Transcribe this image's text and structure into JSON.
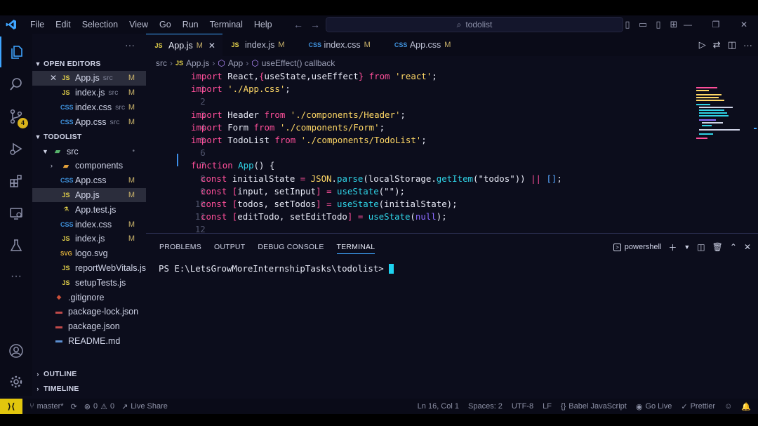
{
  "titlebar": {
    "menu": [
      "File",
      "Edit",
      "Selection",
      "View",
      "Go",
      "Run",
      "Terminal",
      "Help"
    ],
    "search": "todolist"
  },
  "activity": {
    "source_control_badge": "4"
  },
  "sidebar": {
    "open_editors_title": "OPEN EDITORS",
    "open_editors": [
      {
        "name": "App.js",
        "hint": "src",
        "status": "M",
        "icon": "JS"
      },
      {
        "name": "index.js",
        "hint": "src",
        "status": "M",
        "icon": "JS"
      },
      {
        "name": "index.css",
        "hint": "src",
        "status": "M",
        "icon": "CSS"
      },
      {
        "name": "App.css",
        "hint": "src",
        "status": "M",
        "icon": "CSS"
      }
    ],
    "project_title": "TODOLIST",
    "tree": [
      {
        "name": "src",
        "icon": "folder-src",
        "status": "•"
      },
      {
        "name": "components",
        "icon": "folder",
        "status": ""
      },
      {
        "name": "App.css",
        "icon": "CSS",
        "status": "M"
      },
      {
        "name": "App.js",
        "icon": "JS",
        "status": "M"
      },
      {
        "name": "App.test.js",
        "icon": "TEST",
        "status": ""
      },
      {
        "name": "index.css",
        "icon": "CSS",
        "status": "M"
      },
      {
        "name": "index.js",
        "icon": "JS",
        "status": "M"
      },
      {
        "name": "logo.svg",
        "icon": "SVG",
        "status": ""
      },
      {
        "name": "reportWebVitals.js",
        "icon": "JS",
        "status": ""
      },
      {
        "name": "setupTests.js",
        "icon": "JS",
        "status": ""
      },
      {
        "name": ".gitignore",
        "icon": "GIT",
        "status": ""
      },
      {
        "name": "package-lock.json",
        "icon": "JSON",
        "status": ""
      },
      {
        "name": "package.json",
        "icon": "JSON",
        "status": ""
      },
      {
        "name": "README.md",
        "icon": "MD",
        "status": ""
      }
    ],
    "outline_title": "OUTLINE",
    "timeline_title": "TIMELINE"
  },
  "tabs": [
    {
      "name": "App.js",
      "icon": "JS",
      "status": "M"
    },
    {
      "name": "index.js",
      "icon": "JS",
      "status": "M"
    },
    {
      "name": "index.css",
      "icon": "CSS",
      "status": "M"
    },
    {
      "name": "App.css",
      "icon": "CSS",
      "status": "M"
    }
  ],
  "breadcrumb": [
    "src",
    "App.js",
    "App",
    "useEffect() callback"
  ],
  "code_lines": [
    "1",
    "2",
    "3",
    "4",
    "5",
    "6",
    "7",
    "8",
    "9",
    "10",
    "11",
    "12",
    "13"
  ],
  "code": {
    "l1": [
      "import",
      " React,",
      "{",
      "useState,useEffect",
      "}",
      " from",
      " 'react'",
      ";"
    ],
    "l2": [
      "import",
      " './App.css'",
      ";"
    ],
    "l4": [
      "import",
      " Header",
      " from",
      " './components/Header'",
      ";"
    ],
    "l5": [
      "import",
      " Form",
      " from",
      " './components/Form'",
      ";"
    ],
    "l6": [
      "import",
      " TodoList",
      " from",
      " './components/TodoList'",
      ";"
    ],
    "l8": [
      "function",
      " App",
      "()",
      " {"
    ],
    "l9": [
      "const",
      " initialState",
      " =",
      " JSON",
      ".",
      "parse",
      "(",
      "localStorage",
      ".",
      "getItem",
      "(",
      "\"todos\"",
      "))",
      " ||",
      " []",
      ";"
    ],
    "l10": [
      "const",
      " [",
      "input, setInput",
      "]",
      " =",
      " useState",
      "(",
      "\"\"",
      ");"
    ],
    "l11": [
      "const",
      " [",
      "todos, setTodos",
      "]",
      " =",
      " useState",
      "(",
      "initialState",
      ");"
    ],
    "l12": [
      "const",
      " [",
      "editTodo, setEditTodo",
      "]",
      " =",
      " useState",
      "(",
      "null",
      ");"
    ]
  },
  "panel": {
    "tabs": [
      "PROBLEMS",
      "OUTPUT",
      "DEBUG CONSOLE",
      "TERMINAL"
    ],
    "shell": "powershell",
    "prompt": "PS E:\\LetsGrowMoreInternshipTasks\\todolist>"
  },
  "statusbar": {
    "branch": "master*",
    "errors": "0",
    "warnings": "0",
    "live_share": "Live Share",
    "position": "Ln 16, Col 1",
    "spaces": "Spaces: 2",
    "encoding": "UTF-8",
    "eol": "LF",
    "language": "Babel JavaScript",
    "go_live": "Go Live",
    "prettier": "Prettier"
  },
  "colors": {
    "accent": "#3fa5ff",
    "keyword": "#ff4f9a",
    "function": "#2fd3e6",
    "string": "#ffd866",
    "modified": "#c9b26a"
  }
}
